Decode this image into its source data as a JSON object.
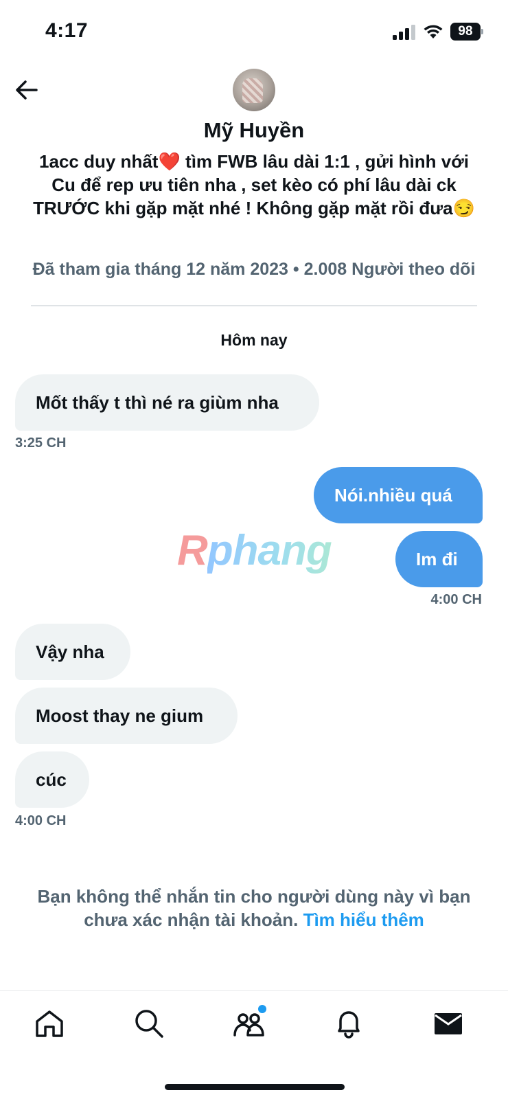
{
  "status_bar": {
    "time": "4:17",
    "battery": "98"
  },
  "profile": {
    "name": "Mỹ Huyền",
    "bio": "1acc duy nhất❤️ tìm FWB lâu dài 1:1 , gửi hình với Cu để rep ưu tiên nha , set kèo có phí lâu dài ck TRƯỚC khi gặp mặt nhé ! Không gặp mặt rồi đưa😏",
    "meta": "Đã tham gia tháng 12 năm 2023 • 2.008 Người theo dõi"
  },
  "conversation": {
    "date_label": "Hôm nay",
    "messages": [
      {
        "text": "Mốt thấy t thì né ra giùm nha",
        "direction": "in"
      },
      {
        "text": "Nói.nhiều quá",
        "direction": "out"
      },
      {
        "text": "Im đi",
        "direction": "out"
      },
      {
        "text": "Vậy nha",
        "direction": "in"
      },
      {
        "text": "Moost thay ne gium",
        "direction": "in"
      },
      {
        "text": "cúc",
        "direction": "in"
      }
    ],
    "timestamps": [
      "3:25 CH",
      "4:00 CH",
      "4:00 CH"
    ]
  },
  "watermark": {
    "text_r": "R",
    "text_rest": "phang"
  },
  "notice": {
    "text": "Bạn không thể nhắn tin cho người dùng này vì bạn chưa xác nhận tài khoản.",
    "link": "Tìm hiểu thêm"
  },
  "tab_bar": {
    "tabs": [
      "home-icon",
      "search-icon",
      "communities-icon",
      "notifications-icon",
      "messages-icon"
    ],
    "active": "messages-icon",
    "communities_badge": true
  },
  "colors": {
    "accent": "#1d9bf0",
    "outgoing_bubble": "#4a9bea",
    "incoming_bubble": "#eff3f4",
    "secondary_text": "#536471"
  }
}
